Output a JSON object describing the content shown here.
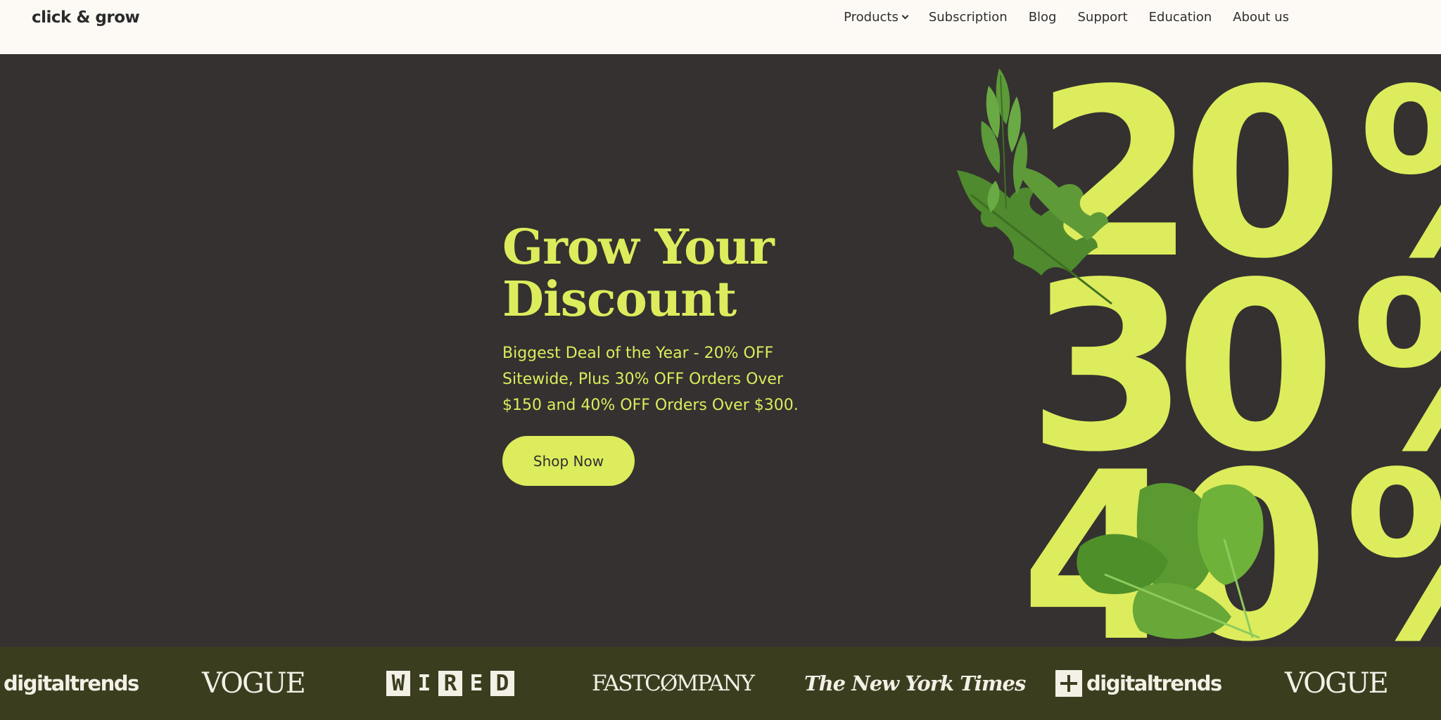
{
  "header": {
    "logo": "click & grow",
    "nav": [
      {
        "label": "Products",
        "has_dropdown": true
      },
      {
        "label": "Subscription"
      },
      {
        "label": "Blog"
      },
      {
        "label": "Support"
      },
      {
        "label": "Education"
      },
      {
        "label": "About us"
      }
    ]
  },
  "hero": {
    "title": "Grow Your Discount",
    "subtitle": "Biggest Deal of the Year - 20% OFF Sitewide, Plus 30% OFF Orders Over $150 and 40% OFF Orders Over $300.",
    "cta_label": "Shop Now",
    "art_digits": [
      "20",
      "30",
      "40"
    ],
    "art_symbol": "%"
  },
  "press": {
    "logos": [
      "digitaltrends",
      "VOGUE",
      "WIRED",
      "FASTCOMPANY",
      "The New York Times",
      "digitaltrends",
      "VOGUE"
    ],
    "fastcompany_display": "FASTCØMPANY"
  },
  "colors": {
    "accent": "#ddec5c",
    "hero_bg": "#343130",
    "press_bg": "#3b3d1f",
    "header_bg": "#fdfaf6",
    "leaf_green": "#4f8a2e"
  }
}
